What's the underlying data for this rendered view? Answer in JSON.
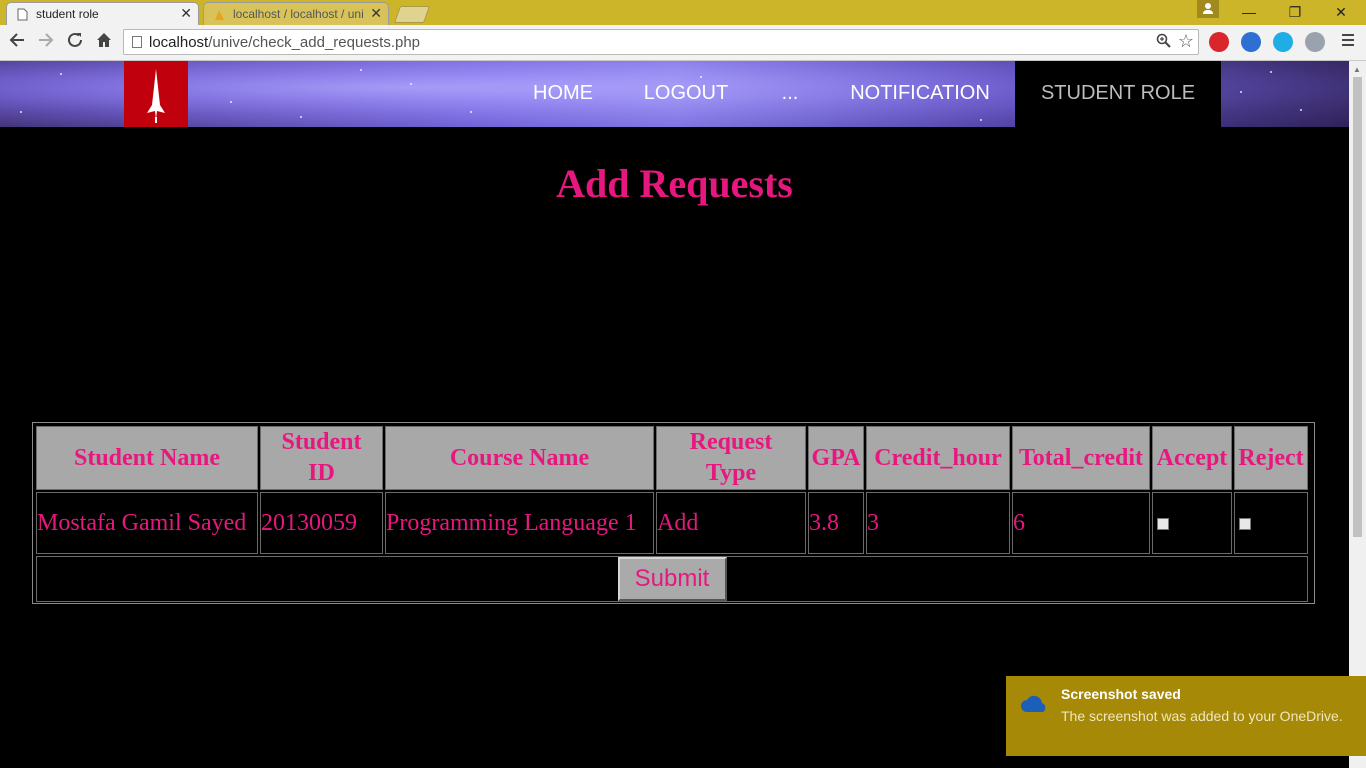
{
  "browser": {
    "tabs": [
      {
        "title": "student role",
        "active": true
      },
      {
        "title": "localhost / localhost / uni",
        "active": false
      }
    ],
    "close_glyph": "✕",
    "window_controls": {
      "minimize": "—",
      "maximize": "❐",
      "close": "✕"
    },
    "url_host": "localhost",
    "url_path": "/unive/check_add_requests.php",
    "extension_colors": [
      "#d9262c",
      "#2d6fd2",
      "#1eaee5",
      "#9aa3ad"
    ]
  },
  "header": {
    "nav": {
      "home": "HOME",
      "logout": "LOGOUT",
      "more": "...",
      "notification": "NOTIFICATION",
      "student_role": "STUDENT ROLE"
    },
    "logo_color": "#c0000c"
  },
  "page": {
    "title": "Add Requests",
    "accent_color": "#e8177f"
  },
  "table": {
    "headers": {
      "student_name": "Student Name",
      "student_id_1": "Student",
      "student_id_2": "ID",
      "course_name": "Course Name",
      "request_type_1": "Request",
      "request_type_2": "Type",
      "gpa": "GPA",
      "credit_hour": "Credit_hour",
      "total_credit": "Total_credit",
      "accept": "Accept",
      "reject": "Reject"
    },
    "rows": [
      {
        "student_name": "Mostafa Gamil Sayed",
        "student_id": "20130059",
        "course_name": "Programming Language 1",
        "request_type": "Add",
        "gpa": "3.8",
        "credit_hour": "3",
        "total_credit": "6",
        "accept_checked": false,
        "reject_checked": false
      }
    ],
    "submit_label": "Submit"
  },
  "toast": {
    "title": "Screenshot saved",
    "message": "The screenshot was added to your OneDrive.",
    "background": "#a68a07"
  }
}
